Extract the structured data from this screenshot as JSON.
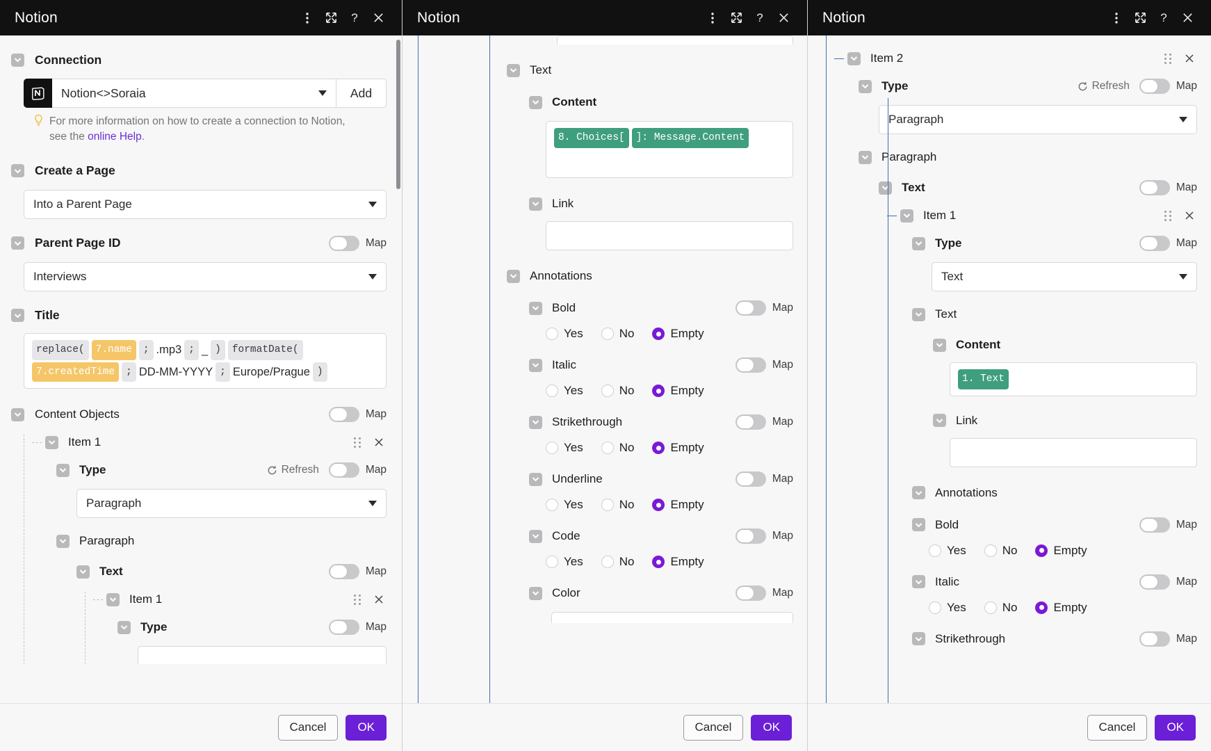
{
  "app": {
    "title": "Notion"
  },
  "titlebar_icons": [
    "kebab-menu-icon",
    "expand-icon",
    "help-icon",
    "close-icon"
  ],
  "footer": {
    "cancel": "Cancel",
    "ok": "OK"
  },
  "panel1": {
    "connection": {
      "label": "Connection",
      "value": "Notion<>Soraia",
      "add_label": "Add",
      "hint_part1": "For more information on how to create a connection to Notion,",
      "hint_part2": "see the ",
      "hint_link": "online Help",
      "hint_part3": "."
    },
    "create_a_page": {
      "label": "Create a Page",
      "value": "Into a Parent Page"
    },
    "parent_page_id": {
      "label": "Parent Page ID",
      "value": "Interviews",
      "map": "Map"
    },
    "title_field": {
      "label": "Title",
      "tokens": [
        {
          "text": "replace(",
          "style": "grey"
        },
        {
          "text": "7.name",
          "style": "yellow"
        },
        {
          "text": ";",
          "style": "grey"
        },
        {
          "text": ".mp3",
          "style": "plain"
        },
        {
          "text": ";",
          "style": "grey"
        },
        {
          "text": "_",
          "style": "plain"
        },
        {
          "text": ")",
          "style": "grey"
        },
        {
          "text": "formatDate(",
          "style": "grey"
        },
        {
          "text": "7.createdTime",
          "style": "yellow"
        },
        {
          "text": ";",
          "style": "grey"
        },
        {
          "text": "DD-MM-YYYY",
          "style": "plain"
        },
        {
          "text": ";",
          "style": "grey"
        },
        {
          "text": "Europe/Prague",
          "style": "plain"
        },
        {
          "text": ")",
          "style": "grey"
        }
      ]
    },
    "content_objects": {
      "label": "Content Objects",
      "map": "Map"
    },
    "item1": {
      "label": "Item 1"
    },
    "type1": {
      "label": "Type",
      "refresh": "Refresh",
      "map": "Map",
      "value": "Paragraph"
    },
    "paragraph": {
      "label": "Paragraph"
    },
    "text": {
      "label": "Text",
      "map": "Map"
    },
    "item1_inner": {
      "label": "Item 1"
    },
    "type_inner": {
      "label": "Type",
      "map": "Map"
    }
  },
  "panel2": {
    "text": {
      "label": "Text"
    },
    "content": {
      "label": "Content",
      "tokens": [
        {
          "text": "8. Choices[",
          "style": "green"
        },
        {
          "text": "]: Message.Content",
          "style": "green"
        }
      ]
    },
    "link": {
      "label": "Link",
      "value": ""
    },
    "annotations": {
      "label": "Annotations"
    },
    "options": [
      "Yes",
      "No",
      "Empty"
    ],
    "selected": "Empty",
    "map": "Map",
    "fields": [
      {
        "label": "Bold"
      },
      {
        "label": "Italic"
      },
      {
        "label": "Strikethrough"
      },
      {
        "label": "Underline"
      },
      {
        "label": "Code"
      },
      {
        "label": "Color"
      }
    ]
  },
  "panel3": {
    "item2": {
      "label": "Item 2"
    },
    "type": {
      "label": "Type",
      "refresh": "Refresh",
      "map": "Map",
      "value": "Paragraph"
    },
    "paragraph": {
      "label": "Paragraph"
    },
    "text_outer": {
      "label": "Text",
      "map": "Map"
    },
    "item1": {
      "label": "Item 1"
    },
    "type_inner": {
      "label": "Type",
      "map": "Map",
      "value": "Text"
    },
    "text_inner": {
      "label": "Text"
    },
    "content": {
      "label": "Content",
      "tokens": [
        {
          "text": "1. Text",
          "style": "green"
        }
      ]
    },
    "link": {
      "label": "Link",
      "value": ""
    },
    "annotations": {
      "label": "Annotations"
    },
    "options": [
      "Yes",
      "No",
      "Empty"
    ],
    "selected": "Empty",
    "map": "Map",
    "fields": [
      {
        "label": "Bold"
      },
      {
        "label": "Italic"
      },
      {
        "label": "Strikethrough"
      }
    ]
  },
  "colors": {
    "accent": "#6b1fd6",
    "radio_on": "#7a19d6",
    "titlebar": "#111112",
    "token_yellow": "#f5c668",
    "token_green": "#3f9e7e",
    "link": "#6b2fd6"
  }
}
